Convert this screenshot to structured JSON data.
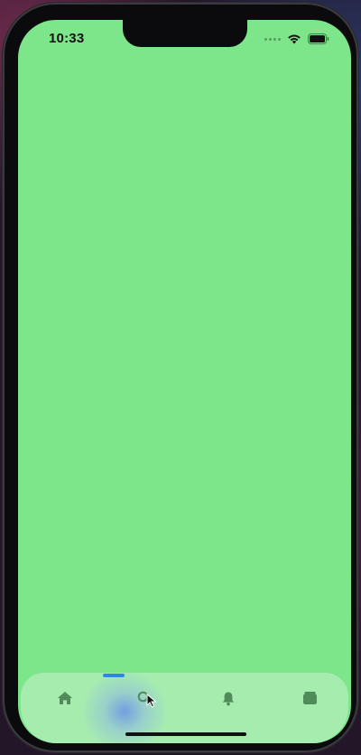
{
  "status_bar": {
    "time": "10:33",
    "icons": [
      "cellular-signal-icon",
      "wifi-icon",
      "battery-icon"
    ]
  },
  "screen": {
    "background_color": "#7de68a"
  },
  "tab_bar": {
    "background_color": "#c8f0cd",
    "accent_color": "#2f86e8",
    "selected_index": 1,
    "tabs": [
      {
        "icon": "home-icon"
      },
      {
        "icon": "search-icon"
      },
      {
        "icon": "bell-icon"
      },
      {
        "icon": "wallet-icon"
      }
    ]
  }
}
